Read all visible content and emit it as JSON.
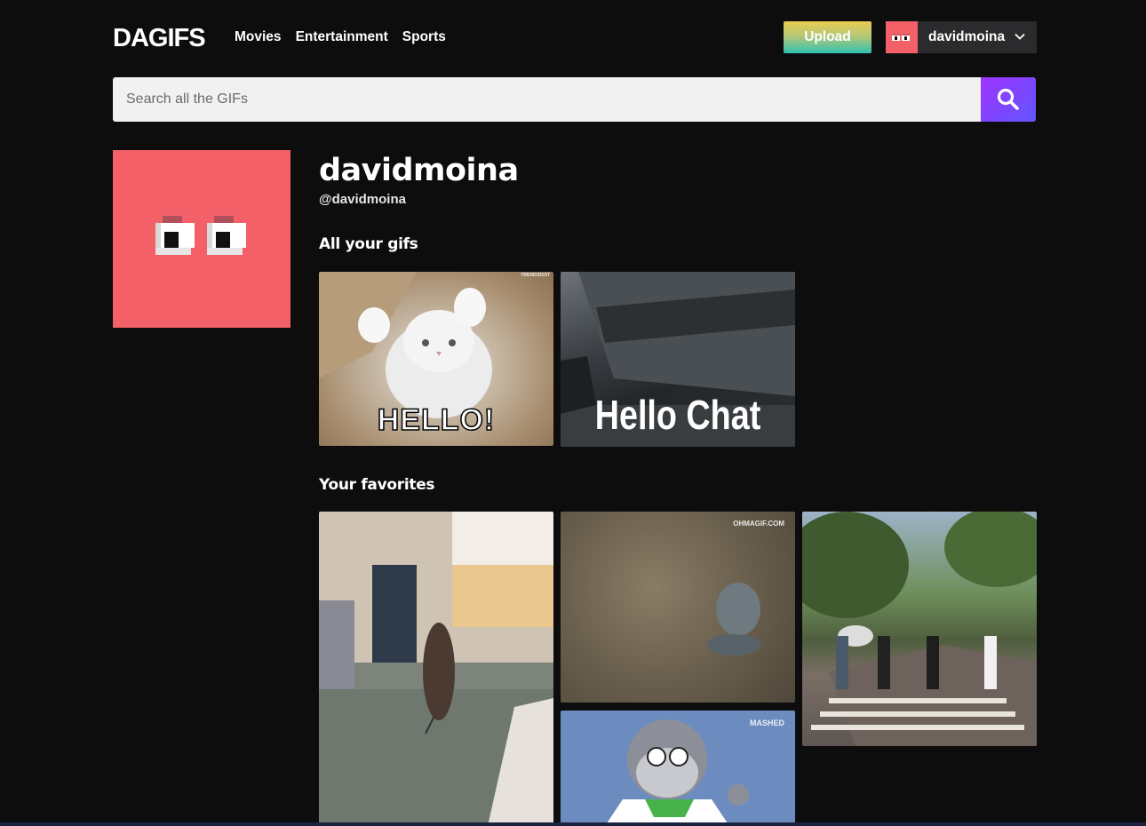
{
  "header": {
    "logo": "DAGIFS",
    "nav": [
      "Movies",
      "Entertainment",
      "Sports"
    ],
    "upload_label": "Upload",
    "user_name": "davidmoina"
  },
  "search": {
    "placeholder": "Search all the GIFs"
  },
  "profile": {
    "display_name": "davidmoina",
    "handle": "@davidmoina",
    "avatar_color": "#f36068"
  },
  "sections": {
    "your_gifs_title": "All your gifs",
    "favorites_title": "Your favorites"
  },
  "your_gifs": [
    {
      "caption": "HELLO!",
      "watermark": "TRENDIZISST"
    },
    {
      "caption": "Hello Chat"
    }
  ],
  "favorites": [
    {
      "scene": "walking-bird-in-living-room"
    },
    {
      "scene": "octopus-on-gravel",
      "watermark": "OHMAGIF.COM"
    },
    {
      "scene": "street-crossing"
    },
    {
      "scene": "cartoon-gorilla-scientist",
      "watermark": "MASHED"
    }
  ],
  "colors": {
    "background": "#0d0d0e",
    "accent_purple": "#9f33ff",
    "accent_teal": "#2fc1b0"
  }
}
